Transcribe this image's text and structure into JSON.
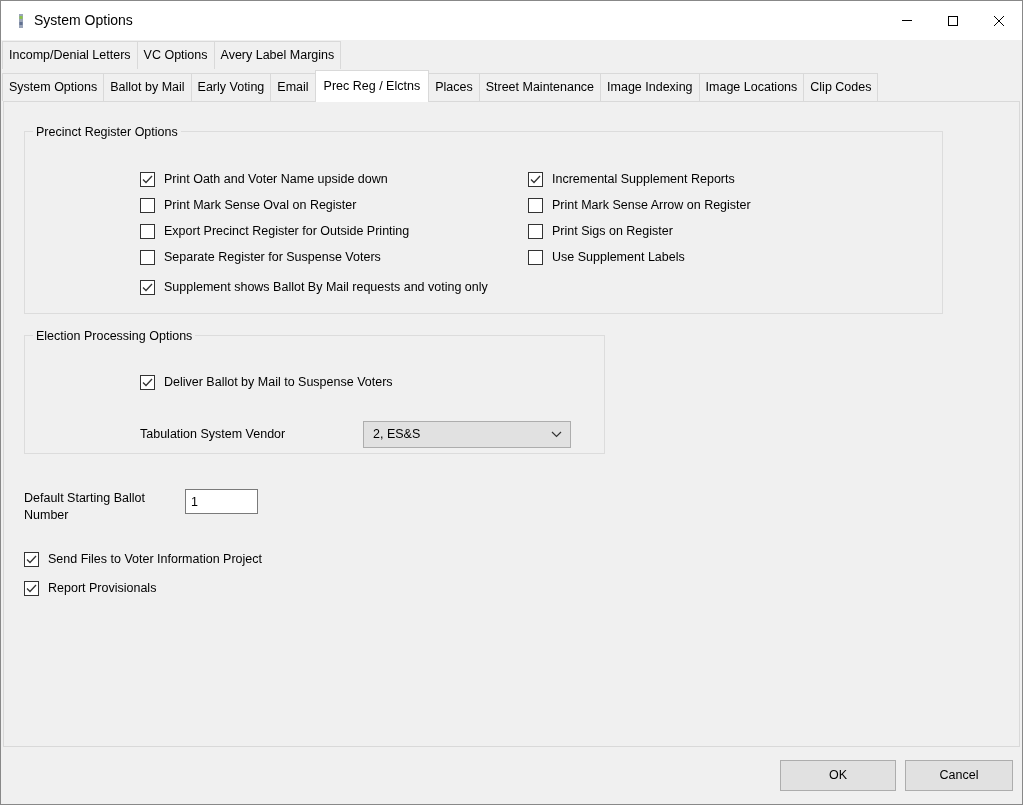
{
  "window": {
    "title": "System Options"
  },
  "tabs_row_1": [
    {
      "label": "Incomp/Denial Letters",
      "selected": false
    },
    {
      "label": "VC Options",
      "selected": false
    },
    {
      "label": "Avery Label Margins",
      "selected": false
    }
  ],
  "tabs_row_2": [
    {
      "label": "System Options",
      "selected": false
    },
    {
      "label": "Ballot by Mail",
      "selected": false
    },
    {
      "label": "Early Voting",
      "selected": false
    },
    {
      "label": "Email",
      "selected": false
    },
    {
      "label": "Prec Reg / Elctns",
      "selected": true
    },
    {
      "label": "Places",
      "selected": false
    },
    {
      "label": "Street Maintenance",
      "selected": false
    },
    {
      "label": "Image Indexing",
      "selected": false
    },
    {
      "label": "Image Locations",
      "selected": false
    },
    {
      "label": "Clip Codes",
      "selected": false
    }
  ],
  "precinct_register_options": {
    "title": "Precinct Register Options",
    "left_column": [
      {
        "label": "Print Oath and Voter Name upside down",
        "checked": true
      },
      {
        "label": "Print Mark Sense Oval on Register",
        "checked": false
      },
      {
        "label": "Export Precinct Register for Outside Printing",
        "checked": false
      },
      {
        "label": "Separate Register for Suspense Voters",
        "checked": false
      },
      {
        "label": "Supplement shows Ballot By Mail requests and voting only",
        "checked": true
      }
    ],
    "right_column": [
      {
        "label": "Incremental Supplement Reports",
        "checked": true
      },
      {
        "label": "Print Mark Sense Arrow on Register",
        "checked": false
      },
      {
        "label": "Print Sigs on Register",
        "checked": false
      },
      {
        "label": "Use Supplement Labels",
        "checked": false
      }
    ]
  },
  "election_processing_options": {
    "title": "Election Processing Options",
    "deliver_ballot": {
      "label": "Deliver Ballot by Mail to Suspense Voters",
      "checked": true
    },
    "tabulation_vendor": {
      "label": "Tabulation System Vendor",
      "value": "2, ES&S"
    }
  },
  "default_starting_ballot_number": {
    "label": "Default Starting Ballot Number",
    "value": "1"
  },
  "options": [
    {
      "label": "Send Files to Voter Information Project",
      "checked": true
    },
    {
      "label": "Report Provisionals",
      "checked": true
    }
  ],
  "buttons": [
    "OK",
    "Cancel"
  ]
}
